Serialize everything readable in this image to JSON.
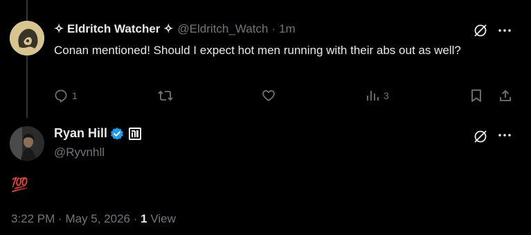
{
  "reply": {
    "display_name": "✧ Eldritch Watcher ✧",
    "handle": "@Eldritch_Watch",
    "separator": "·",
    "time": "1m",
    "text": "Conan mentioned! Should I expect hot men running with their abs out as well?",
    "actions": {
      "reply_count": "1",
      "retweet_count": "",
      "like_count": "",
      "views_count": "3"
    }
  },
  "main_post": {
    "display_name": "Ryan Hill",
    "handle": "@Ryvnhll",
    "text": "💯",
    "meta": {
      "time": "3:22 PM",
      "sep1": "·",
      "date": "May 5, 2026",
      "sep2": "·",
      "views_count": "1",
      "views_label": "View"
    }
  },
  "colors": {
    "background": "#000000",
    "text_primary": "#e7e9ea",
    "text_secondary": "#71767b",
    "verified_blue": "#1d9bf0",
    "thread_line": "#333639"
  },
  "icons": {
    "reply": "reply-icon",
    "retweet": "retweet-icon",
    "like": "like-icon",
    "views": "views-icon",
    "bookmark": "bookmark-icon",
    "share": "share-icon",
    "grok": "grok-icon",
    "more": "more-icon",
    "verified": "verified-badge-icon",
    "affiliate": "affiliate-badge-icon"
  }
}
